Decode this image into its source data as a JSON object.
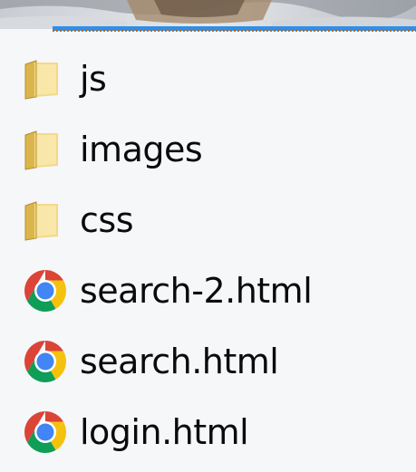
{
  "files": [
    {
      "name": "js",
      "type": "folder",
      "icon": "folder-icon"
    },
    {
      "name": "images",
      "type": "folder",
      "icon": "folder-icon"
    },
    {
      "name": "css",
      "type": "folder",
      "icon": "folder-icon"
    },
    {
      "name": "search-2.html",
      "type": "html",
      "icon": "chrome-icon"
    },
    {
      "name": "search.html",
      "type": "html",
      "icon": "chrome-icon"
    },
    {
      "name": "login.html",
      "type": "html",
      "icon": "chrome-icon"
    }
  ],
  "colors": {
    "selection_stripe": "#2f8fe8",
    "folder": "#e9c76a",
    "chrome_red": "#db4437",
    "chrome_yellow": "#f4c20d",
    "chrome_green": "#0f9d58",
    "chrome_blue": "#4285f4"
  }
}
